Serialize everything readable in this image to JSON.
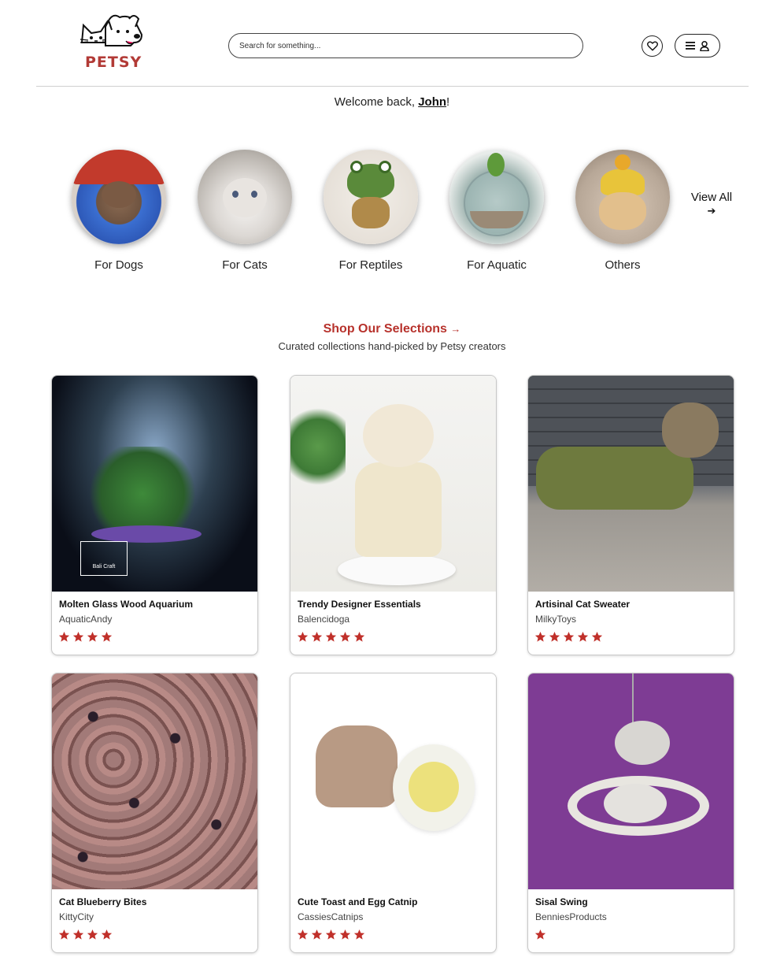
{
  "header": {
    "logo_text": "PETSY",
    "search_placeholder": "Search for something..."
  },
  "welcome": {
    "prefix": "Welcome back, ",
    "user": "John",
    "suffix": "!"
  },
  "categories": [
    {
      "label": "For Dogs"
    },
    {
      "label": "For Cats"
    },
    {
      "label": "For Reptiles"
    },
    {
      "label": "For Aquatic"
    },
    {
      "label": "Others"
    }
  ],
  "view_all": {
    "label": "View All",
    "arrow": "➔"
  },
  "section": {
    "title": "Shop Our Selections",
    "arrow": "→",
    "subtitle": "Curated collections hand-picked by Petsy creators"
  },
  "products": [
    {
      "title": "Molten Glass Wood Aquarium",
      "seller": "AquaticAndy",
      "rating": 4
    },
    {
      "title": "Trendy Designer Essentials",
      "seller": "Balencidoga",
      "rating": 5
    },
    {
      "title": "Artisinal Cat Sweater",
      "seller": "MilkyToys",
      "rating": 5
    },
    {
      "title": "Cat Blueberry Bites",
      "seller": "KittyCity",
      "rating": 4
    },
    {
      "title": "Cute Toast and Egg Catnip",
      "seller": "CassiesCatnips",
      "rating": 5
    },
    {
      "title": "Sisal Swing",
      "seller": "BenniesProducts",
      "rating": 1
    }
  ],
  "colors": {
    "brand": "#b23a36",
    "star": "#c0302a",
    "divider": "#cfcfcf"
  }
}
